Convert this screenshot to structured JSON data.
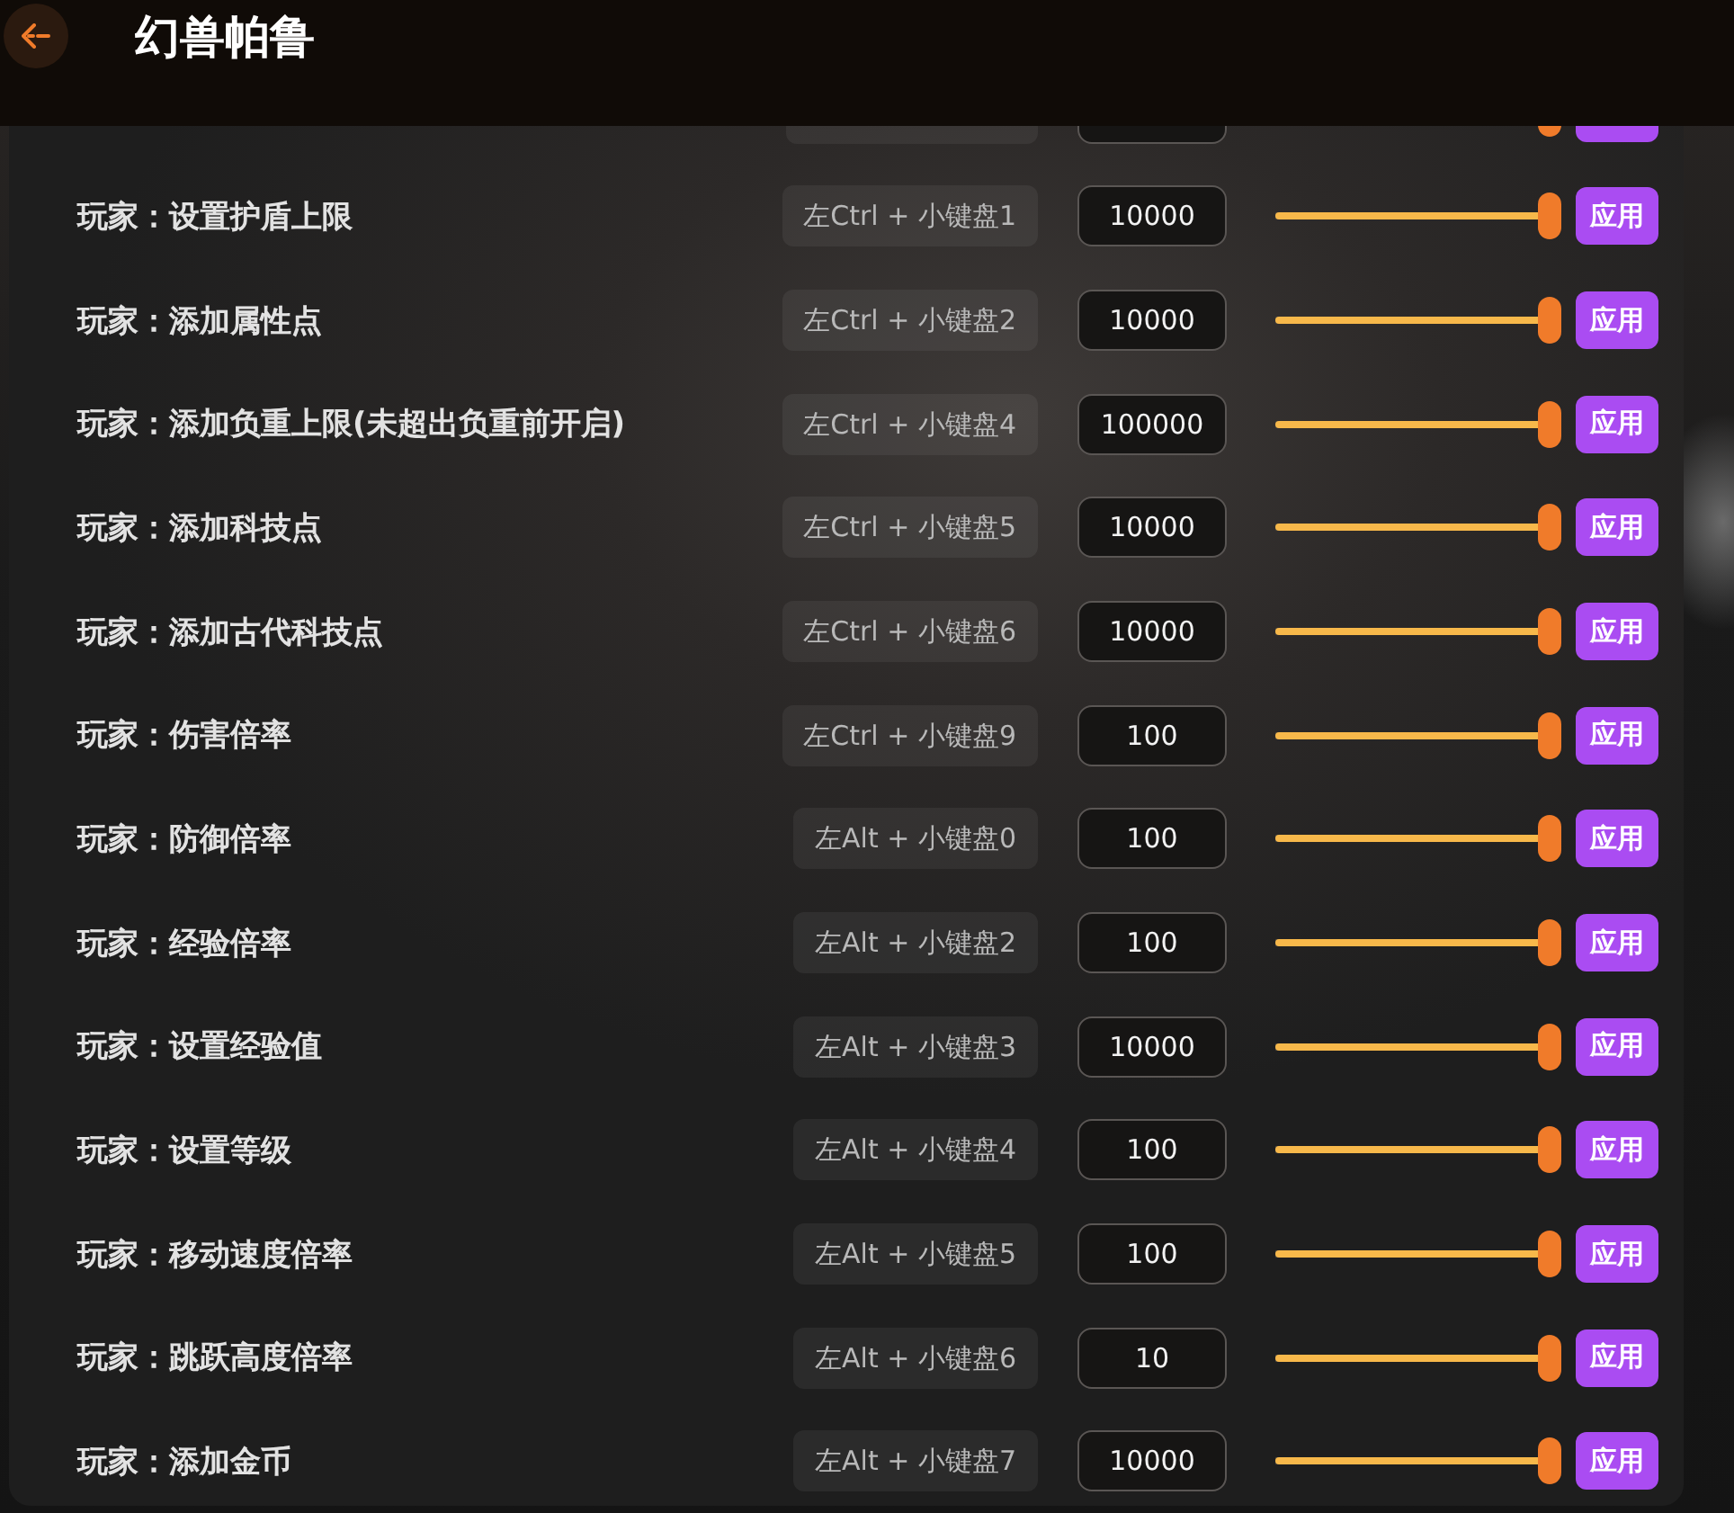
{
  "header": {
    "title": "幻兽帕鲁"
  },
  "rows": [
    {
      "level": 1
    },
    {
      "label": "玩家：设置护盾上限",
      "shortcut": "左Ctrl + 小键盘1",
      "value": "10000",
      "level": 1,
      "button": "应用"
    },
    {
      "label": "玩家：添加属性点",
      "shortcut": "左Ctrl + 小键盘2",
      "value": "10000",
      "level": 1,
      "button": "应用"
    },
    {
      "label": "玩家：添加负重上限(未超出负重前开启)",
      "shortcut": "左Ctrl + 小键盘4",
      "value": "100000",
      "level": 1,
      "button": "应用"
    },
    {
      "label": "玩家：添加科技点",
      "shortcut": "左Ctrl + 小键盘5",
      "value": "10000",
      "level": 1,
      "button": "应用"
    },
    {
      "label": "玩家：添加古代科技点",
      "shortcut": "左Ctrl + 小键盘6",
      "value": "10000",
      "level": 1,
      "button": "应用"
    },
    {
      "label": "玩家：伤害倍率",
      "shortcut": "左Ctrl + 小键盘9",
      "value": "100",
      "level": 1,
      "button": "应用"
    },
    {
      "label": "玩家：防御倍率",
      "shortcut": "左Alt + 小键盘0",
      "value": "100",
      "level": 1,
      "button": "应用"
    },
    {
      "label": "玩家：经验倍率",
      "shortcut": "左Alt + 小键盘2",
      "value": "100",
      "level": 1,
      "button": "应用"
    },
    {
      "label": "玩家：设置经验值",
      "shortcut": "左Alt + 小键盘3",
      "value": "10000",
      "level": 1,
      "button": "应用"
    },
    {
      "label": "玩家：设置等级",
      "shortcut": "左Alt + 小键盘4",
      "value": "100",
      "level": 1,
      "button": "应用"
    },
    {
      "label": "玩家：移动速度倍率",
      "shortcut": "左Alt + 小键盘5",
      "value": "100",
      "level": 1,
      "button": "应用"
    },
    {
      "label": "玩家：跳跃高度倍率",
      "shortcut": "左Alt + 小键盘6",
      "value": "10",
      "level": 1,
      "button": "应用"
    },
    {
      "label": "玩家：添加金币",
      "shortcut": "左Alt + 小键盘7",
      "value": "10000",
      "level": 1,
      "button": "应用"
    }
  ]
}
